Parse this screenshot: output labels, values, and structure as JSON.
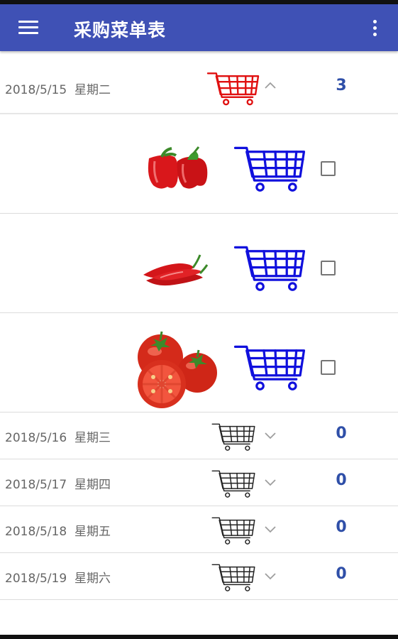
{
  "app": {
    "title": "采购菜单表"
  },
  "colors": {
    "app_bar": "#3f51b5",
    "count_text": "#2f4fa8",
    "cart_expanded": "#e01010",
    "cart_item": "#1010dd",
    "cart_collapsed": "#222222"
  },
  "icons": {
    "menu": "menu-icon",
    "more": "more-vert-icon",
    "cart": "shopping-cart-icon",
    "chevron_up": "chevron-up-icon",
    "chevron_down": "chevron-down-icon",
    "checkbox": "checkbox-icon"
  },
  "groups": [
    {
      "date": "2018/5/15",
      "weekday": "星期二",
      "count": "3",
      "expanded": true,
      "items": [
        {
          "name": "red-bell-pepper",
          "checked": false
        },
        {
          "name": "red-chili-pepper",
          "checked": false
        },
        {
          "name": "tomato",
          "checked": false
        }
      ]
    },
    {
      "date": "2018/5/16",
      "weekday": "星期三",
      "count": "0",
      "expanded": false
    },
    {
      "date": "2018/5/17",
      "weekday": "星期四",
      "count": "0",
      "expanded": false
    },
    {
      "date": "2018/5/18",
      "weekday": "星期五",
      "count": "0",
      "expanded": false
    },
    {
      "date": "2018/5/19",
      "weekday": "星期六",
      "count": "0",
      "expanded": false
    }
  ]
}
